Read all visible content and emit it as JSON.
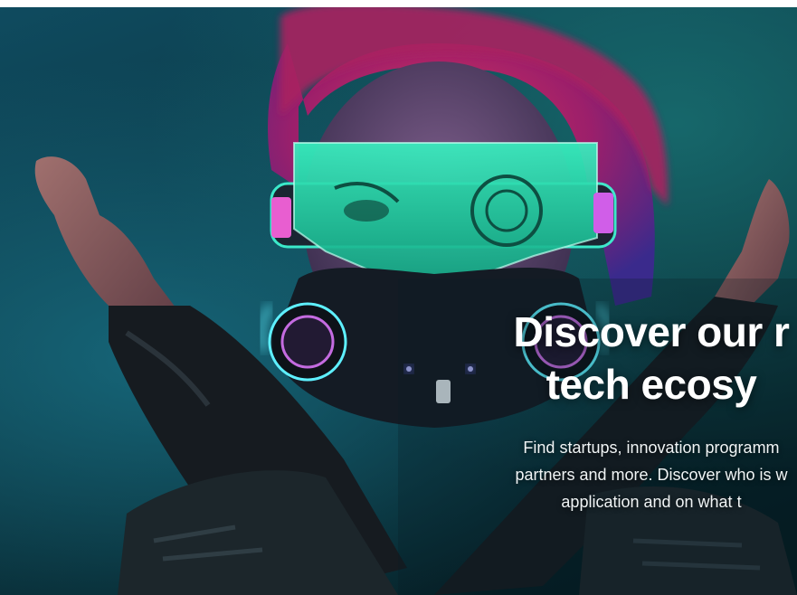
{
  "hero": {
    "title_line_1": "Discover our r",
    "title_line_2": "tech ecosy",
    "desc_line_1": "Find startups, innovation programm",
    "desc_line_2": "partners and more. Discover who is w",
    "desc_line_3": "application and on what t"
  },
  "colors": {
    "background_top": "#0f4b5f",
    "background_bottom": "#041a1f",
    "hair": "#c2264f",
    "visor_glow": "#2ee8b4",
    "text": "#ffffff"
  }
}
